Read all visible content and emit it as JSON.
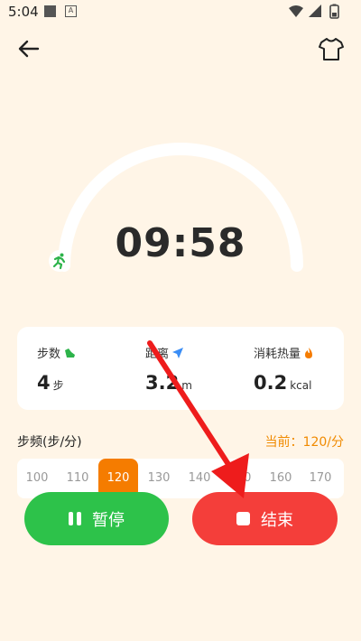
{
  "status_bar": {
    "time": "5:04",
    "notification_icon_letter": "A",
    "icons": [
      "notification-square-icon",
      "app-a-icon",
      "wifi-icon",
      "signal-icon",
      "battery-icon"
    ]
  },
  "nav": {
    "back_icon": "arrow-left-icon",
    "shirt_icon": "t-shirt-icon"
  },
  "timer": {
    "elapsed": "09:58",
    "progress": 0.92,
    "ring_color": "#FFFFFF",
    "badge_icon": "running-person-icon",
    "badge_color": "#2DB34A"
  },
  "stats": [
    {
      "label": "步数",
      "icon": "shoe-icon",
      "icon_color": "#2DB34A",
      "value": "4",
      "unit": "步"
    },
    {
      "label": "距离",
      "icon": "navigation-arrow-icon",
      "icon_color": "#3A8DF5",
      "value": "3.2",
      "unit": "m"
    },
    {
      "label": "消耗热量",
      "icon": "flame-icon",
      "icon_color": "#F57C00",
      "value": "0.2",
      "unit": "kcal"
    }
  ],
  "cadence": {
    "title": "步频(步/分)",
    "current": "当前：120/分",
    "options": [
      "100",
      "110",
      "120",
      "130",
      "140",
      "150",
      "160",
      "170"
    ],
    "selected": "120",
    "accent": "#F57C00"
  },
  "buttons": {
    "pause_label": "暂停",
    "end_label": "结束",
    "pause_color": "#2DC24A",
    "end_color": "#F43E3A"
  },
  "annotation": {
    "arrow_color": "#EE1C1C"
  }
}
